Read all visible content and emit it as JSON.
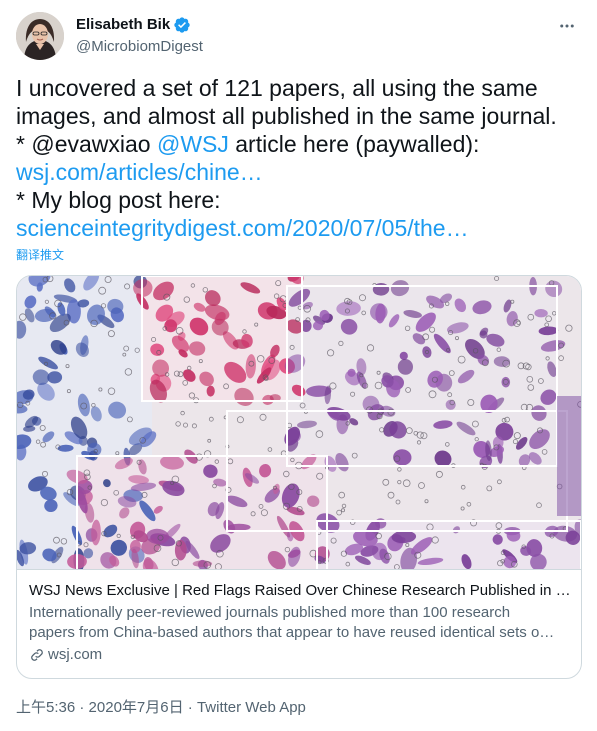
{
  "author": {
    "display_name": "Elisabeth Bik",
    "handle": "@MicrobiomDigest"
  },
  "tweet": {
    "line1": "I uncovered a set of 121 papers, all using the same",
    "line2": "images, and almost all published in the same journal.",
    "line3_prefix": "* ",
    "mention1": "@evawxiao",
    "mention2": "@WSJ",
    "line3_suffix": " article here (paywalled):",
    "link1": "wsj.com/articles/chine…",
    "line5": "* My blog post here:",
    "link2": "scienceintegritydigest.com/2020/07/05/the…",
    "translate": "翻译推文"
  },
  "card": {
    "title": "WSJ News Exclusive | Red Flags Raised Over Chinese Research Published in …",
    "desc_line1": "Internationally peer-reviewed journals published more than 100 research",
    "desc_line2": "papers from China-based authors that appear to have reused identical sets o…",
    "domain": "wsj.com"
  },
  "meta": {
    "time": "上午5:36",
    "sep1": " · ",
    "date": "2020年7月6日",
    "sep2": " · ",
    "source": "Twitter Web App"
  },
  "colors": {
    "link": "#1d9bf0",
    "text": "#0f1419",
    "secondary": "#536471",
    "border": "#cfd9de"
  },
  "icons": [
    "verified-badge-icon",
    "more-options-icon",
    "link-icon"
  ]
}
